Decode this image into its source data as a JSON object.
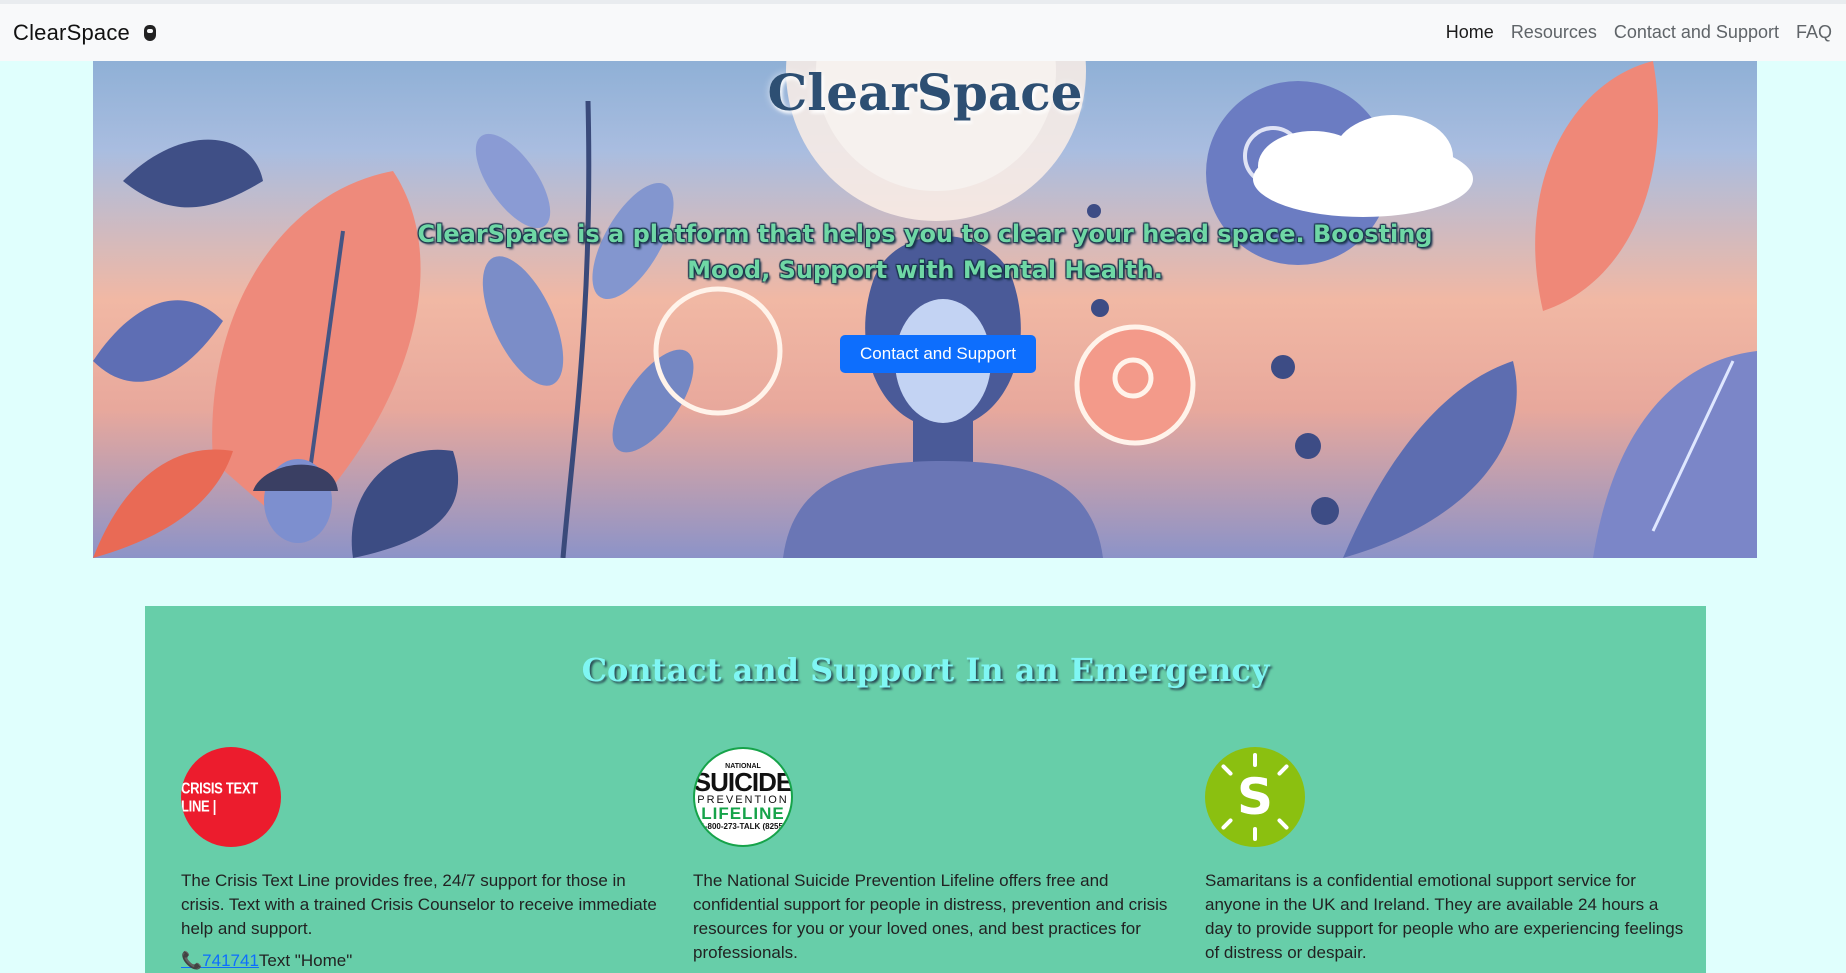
{
  "navbar": {
    "brand": "ClearSpace",
    "brand_icon": "brain-head-icon",
    "links": [
      {
        "label": "Home",
        "active": true
      },
      {
        "label": "Resources",
        "active": false
      },
      {
        "label": "Contact and Support",
        "active": false
      },
      {
        "label": "FAQ",
        "active": false
      }
    ]
  },
  "hero": {
    "title": "ClearSpace",
    "tagline": "ClearSpace is a platform that helps you to clear your head space. Boosting Mood, Support with Mental Health.",
    "button_label": "Contact and Support"
  },
  "support": {
    "heading": "Contact and Support In an Emergency",
    "cards": [
      {
        "logo_text": "CRISIS TEXT LINE |",
        "description": "The Crisis Text Line provides free, 24/7 support for those in crisis. Text with a trained Crisis Counselor to receive immediate help and support.",
        "contact_number": "741741",
        "contact_text": "Text \"Home\"",
        "contact_icon": "phone-icon"
      },
      {
        "logo_lines": [
          "NATIONAL",
          "SUICIDE",
          "PREVENTION",
          "LIFELINE",
          "1-800-273-TALK (8255)"
        ],
        "description": "The National Suicide Prevention Lifeline offers free and confidential support for people in distress, prevention and crisis resources for you or your loved ones, and best practices for professionals."
      },
      {
        "logo_text": "S",
        "description": "Samaritans is a confidential emotional support service for anyone in the UK and Ireland. They are available 24 hours a day to provide support for people who are experiencing feelings of distress or despair."
      }
    ]
  },
  "colors": {
    "page_bg": "#e0fffd",
    "support_bg": "#67cea9",
    "button_primary": "#0d6efd",
    "heading_cyan": "#7ff6f3",
    "tagline_green": "#6fd7a5"
  }
}
